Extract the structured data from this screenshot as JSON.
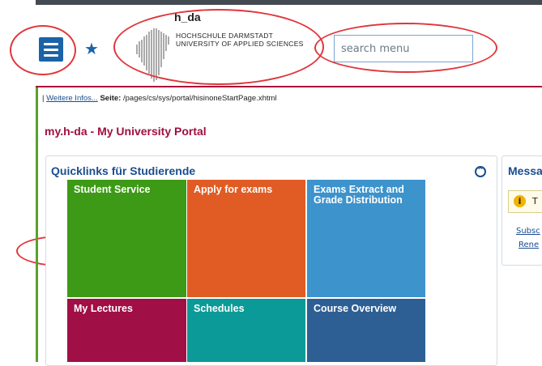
{
  "header": {
    "logo": {
      "name": "h_da",
      "line1": "HOCHSCHULE DARMSTADT",
      "line2": "UNIVERSITY OF APPLIED SCIENCES"
    },
    "search": {
      "placeholder": "search menu",
      "value": ""
    },
    "menu_icon": "hamburger-icon",
    "star_icon": "star-icon"
  },
  "breadcrumb": {
    "separator": "|",
    "link": "Weitere Infos...",
    "page_label": "Seite:",
    "page_path": "/pages/cs/sys/portal/hisinoneStartPage.xhtml"
  },
  "page_title": "my.h-da - My University Portal",
  "quicklinks": {
    "title": "Quicklinks für Studierende",
    "collapse_icon": "chevron-up-circle-icon",
    "tiles": [
      {
        "label": "Student Service",
        "color": "#3d9a16"
      },
      {
        "label": "Apply for exams",
        "color": "#e05c24"
      },
      {
        "label": "Exams Extract and Grade Distribution",
        "color": "#3d93cc"
      },
      {
        "label": "My Lectures",
        "color": "#a00f45"
      },
      {
        "label": "Schedules",
        "color": "#0b9a97"
      },
      {
        "label": "Course Overview",
        "color": "#2e5f94"
      }
    ]
  },
  "messages": {
    "title": "Messa",
    "info_text": "T",
    "link1": "Subsc",
    "link2": "Rene"
  },
  "colors": {
    "accent_blue": "#1a63a8",
    "title_red": "#a00f3e",
    "annotation_red": "#e0363b",
    "side_green": "#5aa02c"
  }
}
